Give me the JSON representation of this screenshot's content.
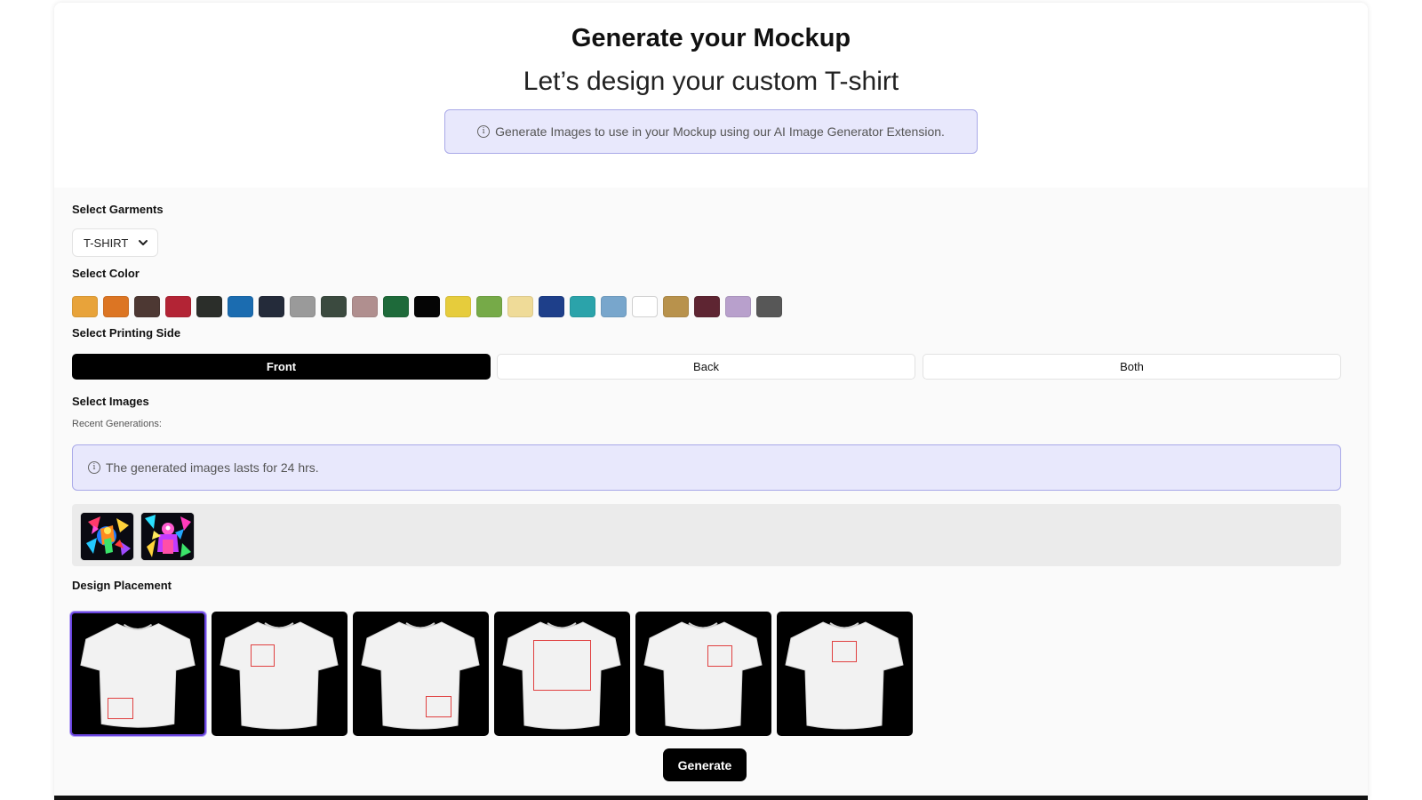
{
  "header": {
    "title": "Generate your Mockup",
    "subtitle": "Let’s design your custom T-shirt",
    "info_banner": "Generate Images to use in your Mockup using our AI Image Generator Extension."
  },
  "garments": {
    "label": "Select Garments",
    "selected": "T-SHIRT"
  },
  "color": {
    "label": "Select Color",
    "swatches": [
      "#e8a33a",
      "#dc7523",
      "#4d3833",
      "#b32435",
      "#2b2e2a",
      "#1b6cb0",
      "#242b3a",
      "#9a9a9a",
      "#3b4a3f",
      "#b08f8f",
      "#1e6a3a",
      "#050505",
      "#e6cc3c",
      "#76aa48",
      "#efdb98",
      "#1e3f8a",
      "#2ba3aa",
      "#78a6cc",
      "#ffffff",
      "#b8924c",
      "#5e2532",
      "#b8a0cc",
      "#575757"
    ]
  },
  "printing_side": {
    "label": "Select Printing Side",
    "options": [
      "Front",
      "Back",
      "Both"
    ],
    "selected": "Front"
  },
  "images": {
    "label": "Select Images",
    "recent_label": "Recent Generations:",
    "info_banner": "The generated images lasts for 24 hrs."
  },
  "placement": {
    "label": "Design Placement",
    "selected_index": 0
  },
  "actions": {
    "generate": "Generate"
  },
  "icons": {
    "info": "info-icon",
    "dropdown": "chevron-down-icon"
  }
}
